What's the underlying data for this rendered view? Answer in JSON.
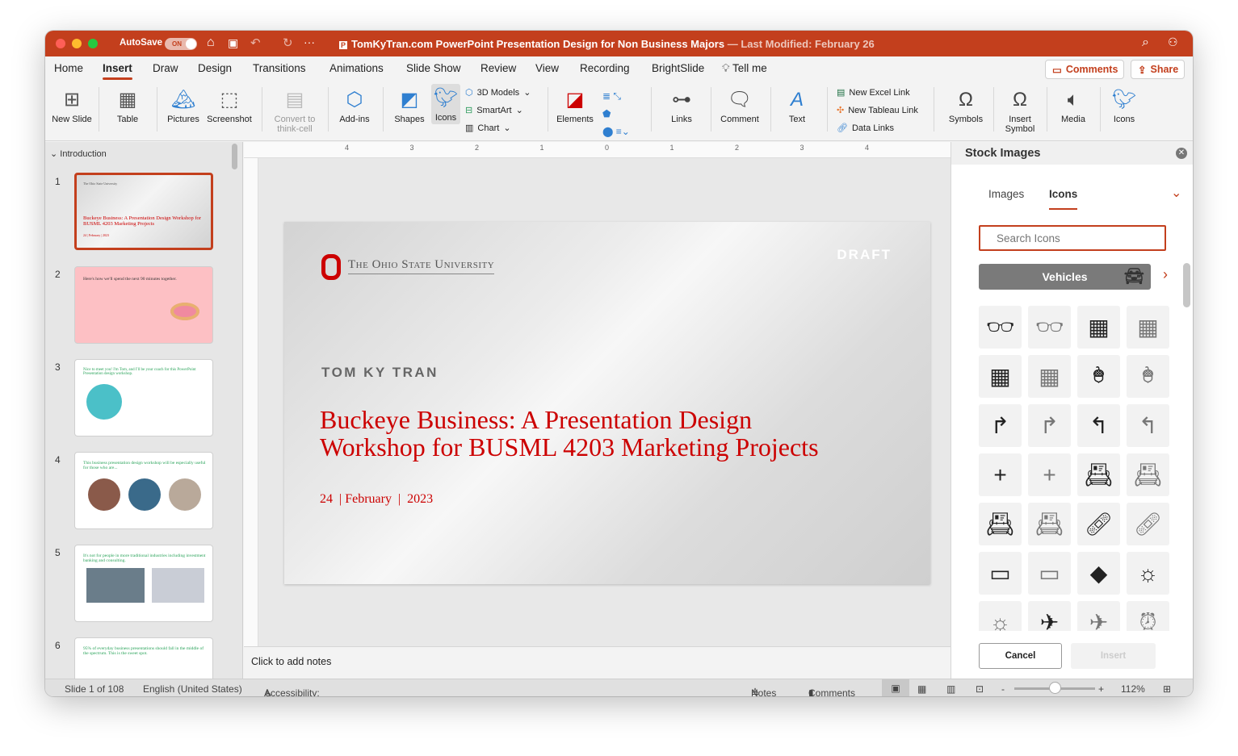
{
  "window": {
    "autosave_label": "AutoSave",
    "autosave_state": "ON",
    "title": "TomKyTran.com PowerPoint Presentation Design for Non Business Majors",
    "last_modified": "— Last Modified: February 26"
  },
  "tabs": [
    "Home",
    "Insert",
    "Draw",
    "Design",
    "Transitions",
    "Animations",
    "Slide Show",
    "Review",
    "View",
    "Recording",
    "BrightSlide"
  ],
  "active_tab": "Insert",
  "tell_me": "Tell me",
  "comments_btn": "Comments",
  "share_btn": "Share",
  "ribbon": {
    "new_slide": "New Slide",
    "table": "Table",
    "pictures": "Pictures",
    "screenshot": "Screenshot",
    "convert": "Convert to think-cell",
    "addins": "Add-ins",
    "shapes": "Shapes",
    "icons": "Icons",
    "models3d": "3D Models",
    "smartart": "SmartArt",
    "chart": "Chart",
    "elements": "Elements",
    "links": "Links",
    "comment": "Comment",
    "text": "Text",
    "excel_link": "New Excel Link",
    "tableau_link": "New Tableau Link",
    "data_links": "Data Links",
    "symbols": "Symbols",
    "insert_symbol": "Insert Symbol",
    "media": "Media",
    "icons2": "Icons"
  },
  "sidebar": {
    "section": "Introduction",
    "slides": [
      {
        "n": "1",
        "kicker": "The Ohio State University",
        "title": "Buckeye Business: A Presentation Design Workshop for BUSML 4203 Marketing Projects",
        "sub": "24 | February | 2023"
      },
      {
        "n": "2",
        "kicker": "",
        "title": "Here's how we'll spend the next 90 minutes together."
      },
      {
        "n": "3",
        "kicker": "",
        "title": "Nice to meet you! I'm Tom, and I'll be your coach for this PowerPoint Presentation design workshop."
      },
      {
        "n": "4",
        "kicker": "",
        "title": "This business presentation design workshop will be especially useful for those who are..."
      },
      {
        "n": "5",
        "kicker": "",
        "title": "It's not for people in more traditional industries including investment banking and consulting."
      },
      {
        "n": "6",
        "kicker": "",
        "title": "95% of everyday business presentations should fall in the middle of the spectrum. This is the sweet spot."
      }
    ]
  },
  "ruler": [
    "4",
    "3",
    "2",
    "1",
    "0",
    "1",
    "2",
    "3",
    "4"
  ],
  "slide": {
    "university": "The Ohio State University",
    "draft": "DRAFT",
    "author": "TOM KY TRAN",
    "title_line1": "Buckeye Business: A Presentation Design",
    "title_line2": "Workshop for BUSML 4203 Marketing Projects",
    "day": "24",
    "month": "February",
    "year": "2023"
  },
  "notes_placeholder": "Click to add notes",
  "panel": {
    "title": "Stock Images",
    "tab_images": "Images",
    "tab_icons": "Icons",
    "search_placeholder": "Search Icons",
    "category": "Vehicles",
    "cancel": "Cancel",
    "insert": "Insert",
    "icons": [
      [
        "3d-glasses-filled",
        "3d-glasses-outline",
        "abacus-filled",
        "abacus-outline"
      ],
      [
        "abacus2-filled",
        "abacus2-outline",
        "acorn-filled",
        "acorn-outline"
      ],
      [
        "turn-right-filled",
        "turn-right-outline",
        "turn-left-filled",
        "turn-left-outline"
      ],
      [
        "add-filled",
        "add-outline",
        "address-book-filled",
        "address-book-outline"
      ],
      [
        "contact-book-filled",
        "contact-book-outline",
        "bandage-filled",
        "bandage-outline"
      ],
      [
        "billboard-filled",
        "billboard-outline",
        "africa-filled",
        "farm-filled"
      ],
      [
        "farm-outline",
        "airplane-filled",
        "airplane-outline",
        "alarm-clock-outline"
      ]
    ]
  },
  "status": {
    "slide": "Slide 1 of 108",
    "language": "English (United States)",
    "accessibility": "Accessibility: Investigate",
    "notes": "Notes",
    "comments": "Comments",
    "zoom": "112%"
  },
  "colors": {
    "titlebar": "#c33f1d",
    "slide_red": "#cc0000",
    "draft": "#ffffff"
  }
}
